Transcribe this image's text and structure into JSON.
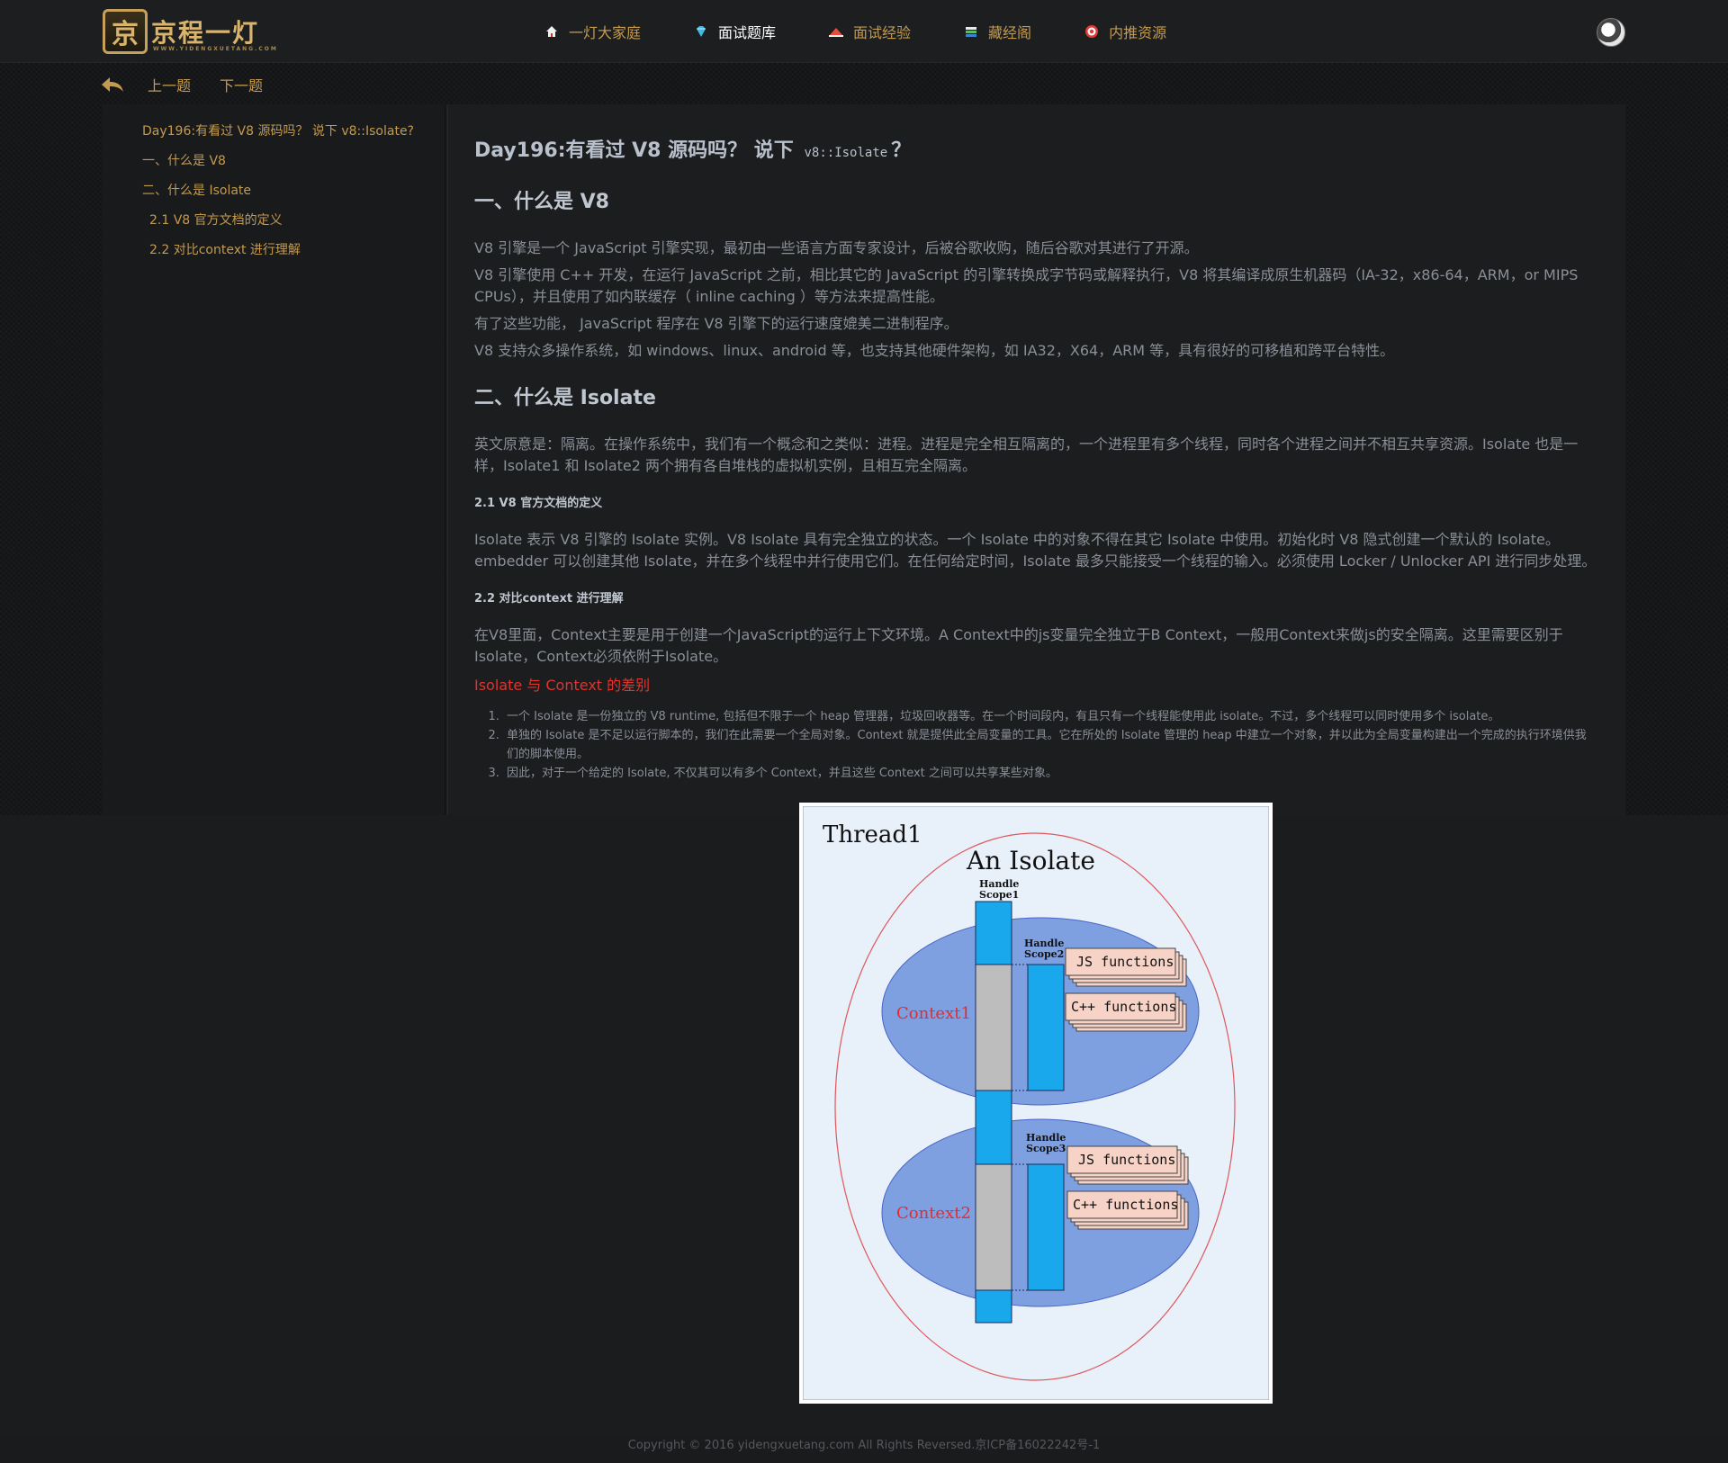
{
  "header": {
    "logo_mark": "京",
    "logo_text": "京程一灯",
    "logo_sub": "WWW.YIDENGXUETANG.COM",
    "nav": [
      {
        "label": "一灯大家庭",
        "icon": "home-icon",
        "active": false
      },
      {
        "label": "面试题库",
        "icon": "diamond-icon",
        "active": true
      },
      {
        "label": "面试经验",
        "icon": "hat-icon",
        "active": false
      },
      {
        "label": "藏经阁",
        "icon": "books-icon",
        "active": false
      },
      {
        "label": "内推资源",
        "icon": "target-icon",
        "active": false
      }
    ]
  },
  "subnav": {
    "prev": "上一题",
    "next": "下一题"
  },
  "toc": [
    {
      "label": "Day196:有看过 V8 源码吗？ 说下 v8::Isolate?",
      "level": 1
    },
    {
      "label": "一、什么是 V8",
      "level": 1
    },
    {
      "label": "二、什么是 Isolate",
      "level": 1
    },
    {
      "label": "2.1 V8 官方文档的定义",
      "level": 2
    },
    {
      "label": "2.2 对比context 进行理解",
      "level": 2
    }
  ],
  "article": {
    "title_pre": "Day196:有看过 V8 源码吗？ 说下",
    "title_code": "v8::Isolate",
    "title_post": "？",
    "sec1_title": "一、什么是 V8",
    "sec1_p1": "V8 引擎是一个 JavaScript 引擎实现，最初由一些语言方面专家设计，后被谷歌收购，随后谷歌对其进行了开源。",
    "sec1_p2": "V8 引擎使用 C++ 开发，在运行 JavaScript 之前，相比其它的 JavaScript 的引擎转换成字节码或解释执行，V8 将其编译成原生机器码（IA-32，x86-64，ARM，or MIPS CPUs），并且使用了如内联缓存（ inline caching ）等方法来提高性能。",
    "sec1_p3": "有了这些功能， JavaScript 程序在 V8 引擎下的运行速度媲美二进制程序。",
    "sec1_p4": "V8 支持众多操作系统，如 windows、linux、android 等，也支持其他硬件架构，如 IA32，X64，ARM 等，具有很好的可移植和跨平台特性。",
    "sec2_title": "二、什么是 Isolate",
    "sec2_p1": "英文原意是：隔离。在操作系统中，我们有一个概念和之类似：进程。进程是完全相互隔离的，一个进程里有多个线程，同时各个进程之间并不相互共享资源。Isolate 也是一样，Isolate1 和 Isolate2 两个拥有各自堆栈的虚拟机实例，且相互完全隔离。",
    "sec21_title": "2.1 V8 官方文档的定义",
    "sec21_p1": "Isolate 表示 V8 引擎的 Isolate 实例。V8 Isolate 具有完全独立的状态。一个 Isolate 中的对象不得在其它 Isolate 中使用。初始化时 V8 隐式创建一个默认的 Isolate。embedder 可以创建其他 Isolate，并在多个线程中并行使用它们。在任何给定时间，Isolate 最多只能接受一个线程的输入。必须使用 Locker / Unlocker API 进行同步处理。",
    "sec22_title": "2.2 对比context 进行理解",
    "sec22_p1": "在V8里面，Context主要是用于创建一个JavaScript的运行上下文环境。A Context中的js变量完全独立于B Context，一般用Context来做js的安全隔离。这里需要区别于Isolate，Context必须依附于Isolate。",
    "diff_title": "Isolate 与 Context 的差别",
    "diff_list": [
      "一个 Isolate 是一份独立的 V8 runtime, 包括但不限于一个 heap 管理器，垃圾回收器等。在一个时间段内，有且只有一个线程能使用此 isolate。不过，多个线程可以同时使用多个 isolate。",
      "单独的 Isolate 是不足以运行脚本的，我们在此需要一个全局对象。Context 就是提供此全局变量的工具。它在所处的 Isolate 管理的 heap 中建立一个对象，并以此为全局变量构建出一个完成的执行环境供我们的脚本使用。",
      "因此，对于一个给定的 Isolate, 不仅其可以有多个 Context，并且这些 Context 之间可以共享某些对象。"
    ]
  },
  "diagram": {
    "thread": "Thread1",
    "isolate": "An Isolate",
    "scope1": [
      "Handle",
      "Scope1"
    ],
    "scope2": [
      "Handle",
      "Scope2"
    ],
    "scope3": [
      "Handle",
      "Scope3"
    ],
    "context1": "Context1",
    "context2": "Context2",
    "js_functions": "JS functions",
    "cpp_functions": "C++ functions"
  },
  "footer": {
    "text": "Copyright © 2016 yidengxuetang.com All Rights Reversed.京ICP备16022242号-1"
  }
}
